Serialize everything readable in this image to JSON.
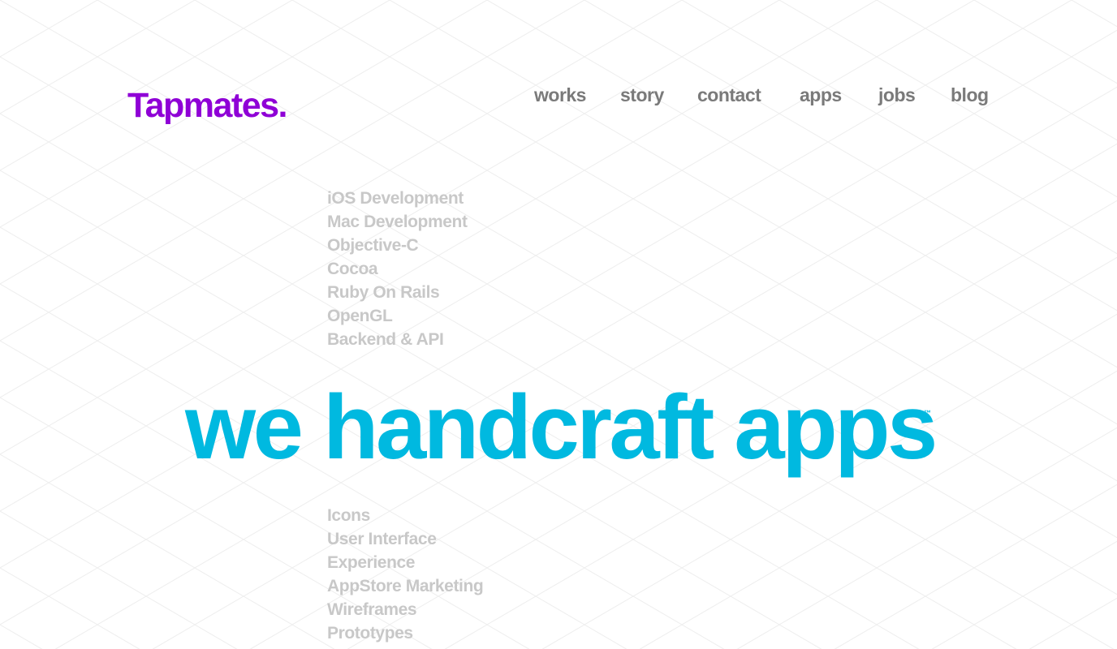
{
  "brand": {
    "logo_text": "Tapmates.",
    "logo_color": "#8f00d6"
  },
  "nav": {
    "color": "#7a7a7a",
    "items": [
      {
        "label": "works"
      },
      {
        "label": "story"
      },
      {
        "label": "contact"
      },
      {
        "label": "apps"
      },
      {
        "label": "jobs"
      },
      {
        "label": "blog"
      }
    ]
  },
  "skills_development": {
    "color": "#c8c8c8",
    "items": [
      "iOS Development",
      "Mac Development",
      "Objective-C",
      "Cocoa",
      "Ruby On Rails",
      "OpenGL",
      "Backend & API"
    ]
  },
  "hero": {
    "headline": "we handcraft apps",
    "trademark": "™",
    "color": "#00b9e0"
  },
  "skills_design": {
    "color": "#c8c8c8",
    "items": [
      "Icons",
      "User Interface",
      "Experience",
      "AppStore Marketing",
      "Wireframes",
      "Prototypes"
    ]
  },
  "background": {
    "color": "#ffffff",
    "grid_line_color": "#eeeeee"
  }
}
